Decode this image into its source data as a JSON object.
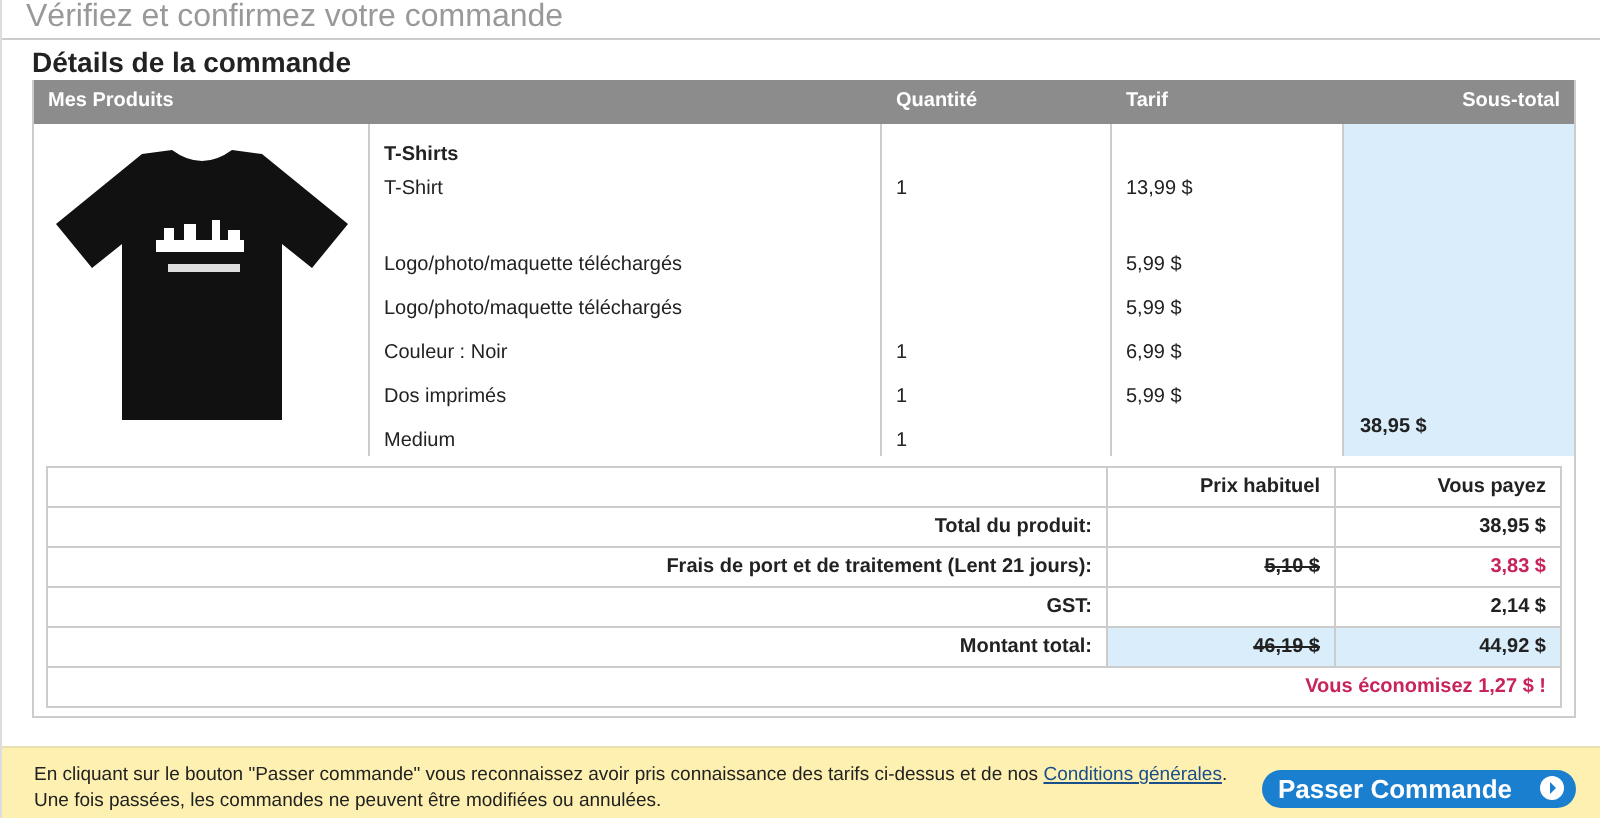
{
  "page_title": "Vérifiez et confirmez votre commande",
  "section_title": "Détails de la commande",
  "order_table": {
    "columns": [
      "Mes Produits",
      "Quantité",
      "Tarif",
      "Sous-total"
    ],
    "product": {
      "group": "T-Shirts",
      "lines": [
        {
          "description": "T-Shirt",
          "quantity": "1",
          "price": "13,99 $"
        },
        {
          "description": "Logo/photo/maquette téléchargés",
          "price": "5,99 $"
        },
        {
          "description": "Logo/photo/maquette téléchargés",
          "price": "5,99 $"
        },
        {
          "description": "Couleur : Noir",
          "quantity": "1",
          "price": "6,99 $"
        },
        {
          "description": "Dos imprimés",
          "quantity": "1",
          "price": "5,99 $"
        },
        {
          "description": "Medium",
          "quantity": "1"
        }
      ],
      "subtotal": "38,95 $"
    }
  },
  "totals": {
    "columns": [
      "Prix habituel",
      "Vous payez"
    ],
    "rows": [
      {
        "label": "Total du produit:",
        "you_pay": "38,95 $",
        "discounted": false,
        "highlighted": false
      },
      {
        "label": "Frais de port et de traitement (Lent 21 jours):",
        "regular_price": "5,10 $",
        "you_pay": "3,83 $",
        "discounted": true,
        "highlighted": false
      },
      {
        "label": "GST:",
        "you_pay": "2,14 $",
        "discounted": false,
        "highlighted": false
      },
      {
        "label": "Montant total:",
        "regular_price": "46,19 $",
        "you_pay": "44,92 $",
        "discounted": false,
        "highlighted": true
      }
    ],
    "savings": "Vous économisez 1,27 $ !"
  },
  "footer": {
    "notice": "En cliquant sur le bouton \"Passer commande\" vous reconnaissez avoir pris connaissance des tarifs ci-dessus et de nos ",
    "link": "Conditions générales",
    "notice_end": ".",
    "notice_line2": "Une fois passées, les commandes ne peuvent être modifiées ou annulées.",
    "button": "Passer Commande"
  }
}
